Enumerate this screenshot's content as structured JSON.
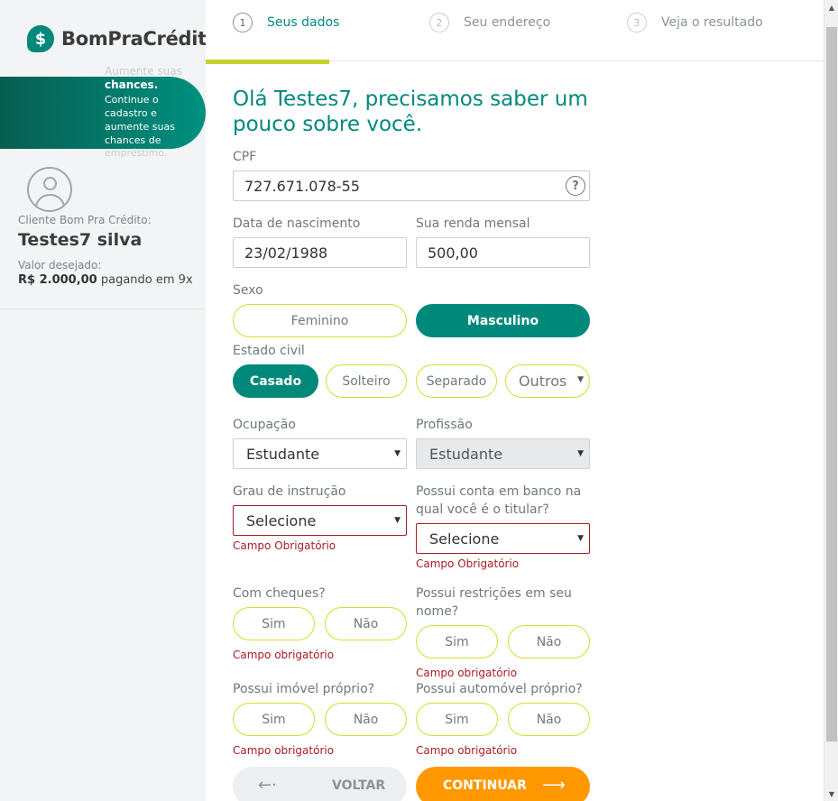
{
  "brand": {
    "name": "BomPraCrédito",
    "mark": "$"
  },
  "banner": {
    "ghost": "Aumente suas",
    "title": "chances.",
    "text": "Continue o cadastro e aumente suas chances de",
    "tail": "empréstimo."
  },
  "client": {
    "label": "Cliente Bom Pra Crédito:",
    "name": "Testes7 silva",
    "value_label": "Valor desejado:",
    "value_amount": "R$ 2.000,00",
    "value_terms": "pagando em 9x"
  },
  "steps": [
    {
      "num": "1",
      "label": "Seus dados",
      "active": true
    },
    {
      "num": "2",
      "label": "Seu endereço",
      "active": false
    },
    {
      "num": "3",
      "label": "Veja o resultado",
      "active": false
    }
  ],
  "form": {
    "greeting": "Olá Testes7, precisamos saber um pouco sobre você.",
    "cpf": {
      "label": "CPF",
      "value": "727.671.078-55",
      "help": "?"
    },
    "birth": {
      "label": "Data de nascimento",
      "value": "23/02/1988"
    },
    "income": {
      "label": "Sua renda mensal",
      "value": "500,00"
    },
    "sex": {
      "label": "Sexo",
      "options": [
        "Feminino",
        "Masculino"
      ],
      "selected": "Masculino"
    },
    "civil": {
      "label": "Estado civil",
      "options": [
        "Casado",
        "Solteiro",
        "Separado",
        "Outros"
      ],
      "selected": "Casado"
    },
    "occupation": {
      "label": "Ocupação",
      "value": "Estudante"
    },
    "profession": {
      "label": "Profissão",
      "value": "Estudante"
    },
    "education": {
      "label": "Grau de instrução",
      "value": "Selecione",
      "error": "Campo Obrigatório"
    },
    "bank": {
      "label": "Possui conta em banco na qual você é o titular?",
      "value": "Selecione",
      "error": "Campo Obrigatório"
    },
    "cheques": {
      "label": "Com cheques?",
      "yes": "Sim",
      "no": "Não",
      "error": "Campo obrigatório"
    },
    "restrictions": {
      "label": "Possui restrições em seu nome?",
      "yes": "Sim",
      "no": "Não",
      "error": "Campo obrigatório"
    },
    "property": {
      "label": "Possui imóvel próprio?",
      "yes": "Sim",
      "no": "Não",
      "error": "Campo obrigatório"
    },
    "vehicle": {
      "label": "Possui automóvel próprio?",
      "yes": "Sim",
      "no": "Não",
      "error": "Campo obrigatório"
    }
  },
  "actions": {
    "back": "VOLTAR",
    "next": "CONTINUAR",
    "back_arrow": "←·",
    "next_arrow": "⟶"
  },
  "icons": {
    "caret": "▼",
    "scroll_up": "▲",
    "scroll_down": "▼"
  },
  "colors": {
    "primary": "#00897b",
    "accent": "#ff9800",
    "outline": "#d5dd2c",
    "error": "#a61d24"
  }
}
